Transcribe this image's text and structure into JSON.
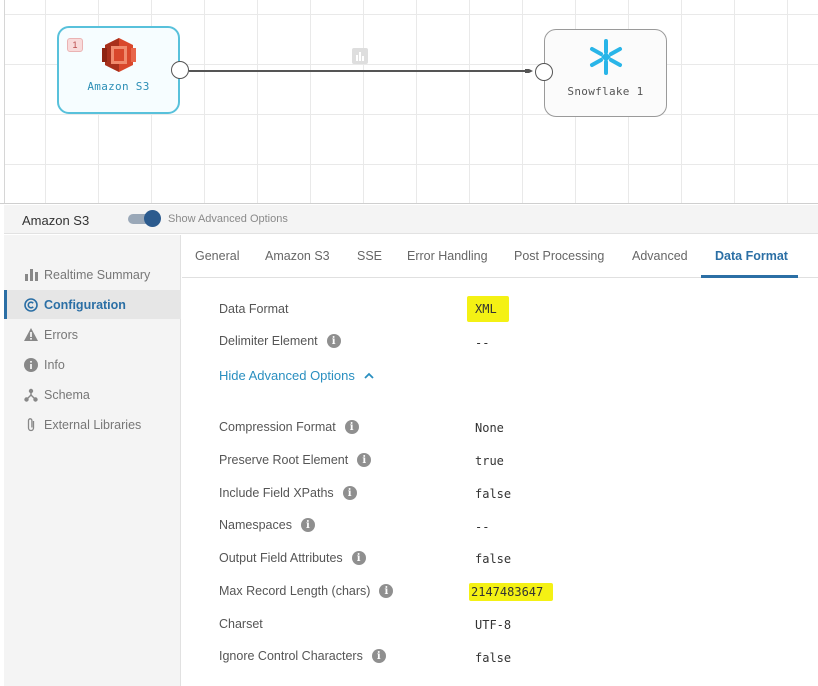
{
  "pipeline": {
    "source_stage": {
      "label": "Amazon S3",
      "error_count": "1"
    },
    "dest_stage": {
      "label": "Snowflake 1"
    }
  },
  "stage_header": {
    "title": "Amazon S3",
    "toggle_label": "Show Advanced Options",
    "toggle_on": true
  },
  "sidebar": {
    "items": [
      {
        "label": "Realtime Summary",
        "icon": "bar-chart-icon",
        "active": false
      },
      {
        "label": "Configuration",
        "icon": "copyright-circle-icon",
        "active": true
      },
      {
        "label": "Errors",
        "icon": "warning-triangle-icon",
        "active": false
      },
      {
        "label": "Info",
        "icon": "info-circle-icon",
        "active": false
      },
      {
        "label": "Schema",
        "icon": "schema-tree-icon",
        "active": false
      },
      {
        "label": "External Libraries",
        "icon": "paperclip-icon",
        "active": false
      }
    ]
  },
  "tabs": [
    {
      "label": "General",
      "active": false
    },
    {
      "label": "Amazon S3",
      "active": false
    },
    {
      "label": "SSE",
      "active": false
    },
    {
      "label": "Error Handling",
      "active": false
    },
    {
      "label": "Post Processing",
      "active": false
    },
    {
      "label": "Advanced",
      "active": false
    },
    {
      "label": "Data Format",
      "active": true
    }
  ],
  "form": {
    "data_format": {
      "label": "Data Format",
      "value": "XML"
    },
    "delimiter_element": {
      "label": "Delimiter Element",
      "value": "--"
    },
    "hide_advanced_label": "Hide Advanced Options",
    "compression_format": {
      "label": "Compression Format",
      "value": "None"
    },
    "preserve_root_element": {
      "label": "Preserve Root Element",
      "value": "true"
    },
    "include_field_xpaths": {
      "label": "Include Field XPaths",
      "value": "false"
    },
    "namespaces": {
      "label": "Namespaces",
      "value": "--"
    },
    "output_field_attributes": {
      "label": "Output Field Attributes",
      "value": "false"
    },
    "max_record_length": {
      "label": "Max Record Length (chars)",
      "value": "2147483647"
    },
    "charset": {
      "label": "Charset",
      "value": "UTF-8"
    },
    "ignore_control_characters": {
      "label": "Ignore Control Characters",
      "value": "false"
    }
  },
  "colors": {
    "accent": "#2b6fa5",
    "link": "#2a8fc0",
    "highlight": "#f4f114",
    "s3_red": "#d9472b",
    "snowflake_blue": "#29b5e8"
  }
}
